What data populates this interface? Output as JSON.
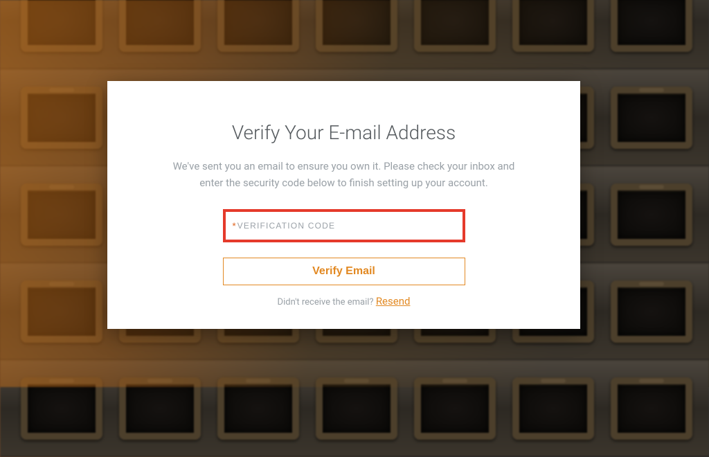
{
  "card": {
    "title": "Verify Your E-mail Address",
    "description": "We've sent you an email to ensure you own it. Please check your inbox and enter the security code below to finish setting up your account.",
    "code_placeholder": "VERIFICATION CODE",
    "code_value": "",
    "verify_button_label": "Verify Email",
    "resend_prompt": "Didn't receive the email?",
    "resend_link_label": "Resend"
  },
  "colors": {
    "accent": "#e28923",
    "highlight_border": "#e53a2b"
  }
}
